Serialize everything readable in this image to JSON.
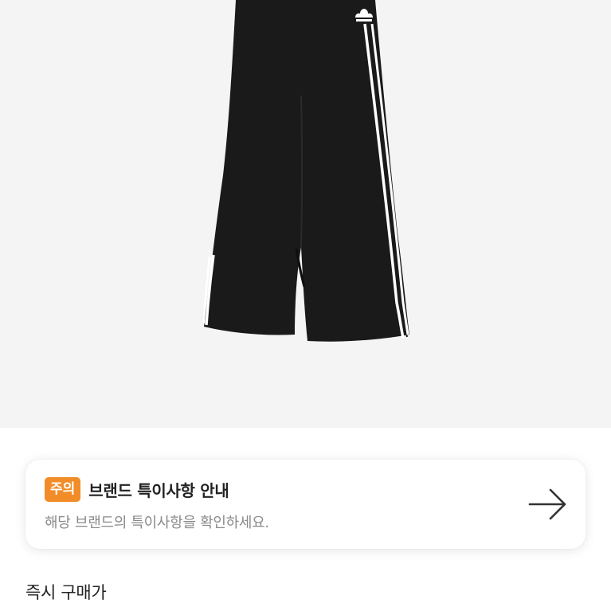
{
  "product_image": {
    "logo_icon": "adidas-trefoil-icon",
    "stripe_color": "#ffffff",
    "garment_color": "#1a1a1a",
    "background_color": "#f4f4f4"
  },
  "notice": {
    "badge": "주의",
    "badge_color": "#f28c28",
    "title": "브랜드 특이사항 안내",
    "description": "해당 브랜드의 특이사항을 확인하세요.",
    "arrow_icon": "arrow-right-icon"
  },
  "price_section": {
    "label": "즉시 구매가"
  }
}
